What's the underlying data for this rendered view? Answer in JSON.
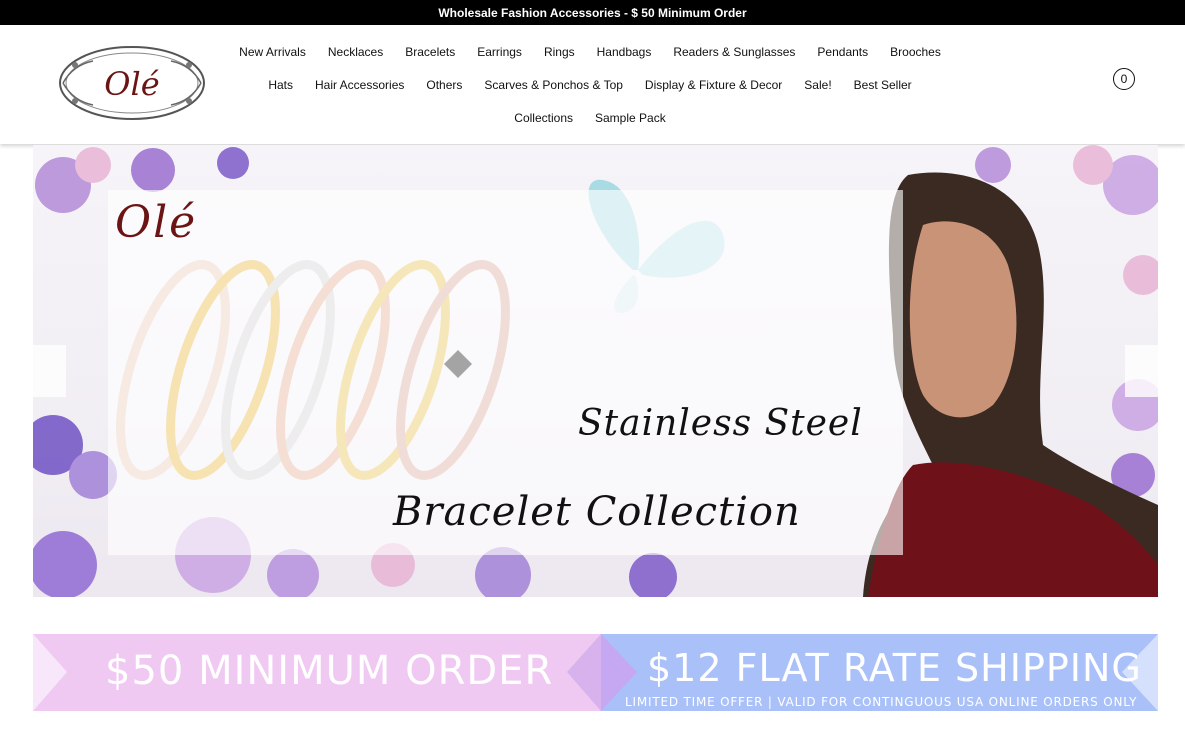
{
  "announcement": "Wholesale Fashion Accessories - $ 50 Minimum Order",
  "logo": {
    "text": "Olé"
  },
  "nav": {
    "row1": [
      "New Arrivals",
      "Necklaces",
      "Bracelets",
      "Earrings",
      "Rings",
      "Handbags",
      "Readers & Sunglasses",
      "Pendants",
      "Brooches"
    ],
    "row2": [
      "Hats",
      "Hair Accessories",
      "Others",
      "Scarves & Ponchos & Top",
      "Display & Fixture & Decor",
      "Sale!",
      "Best Seller"
    ],
    "row3": [
      "Collections",
      "Sample Pack"
    ]
  },
  "cart": {
    "count": "0"
  },
  "hero": {
    "logo": "Olé",
    "line1": "Stainless Steel",
    "line2": "Bracelet Collection"
  },
  "promos": {
    "left": "$50 MINIMUM ORDER",
    "right_title": "$12 FLAT RATE SHIPPING",
    "right_sub": "LIMITED TIME OFFER | VALID FOR CONTINGUOUS USA ONLINE ORDERS ONLY"
  },
  "colors": {
    "announce_bg": "#000000",
    "logo_red": "#6b1414",
    "promo_pink": "#f0c9f3",
    "promo_blue": "#a9c1f8"
  }
}
